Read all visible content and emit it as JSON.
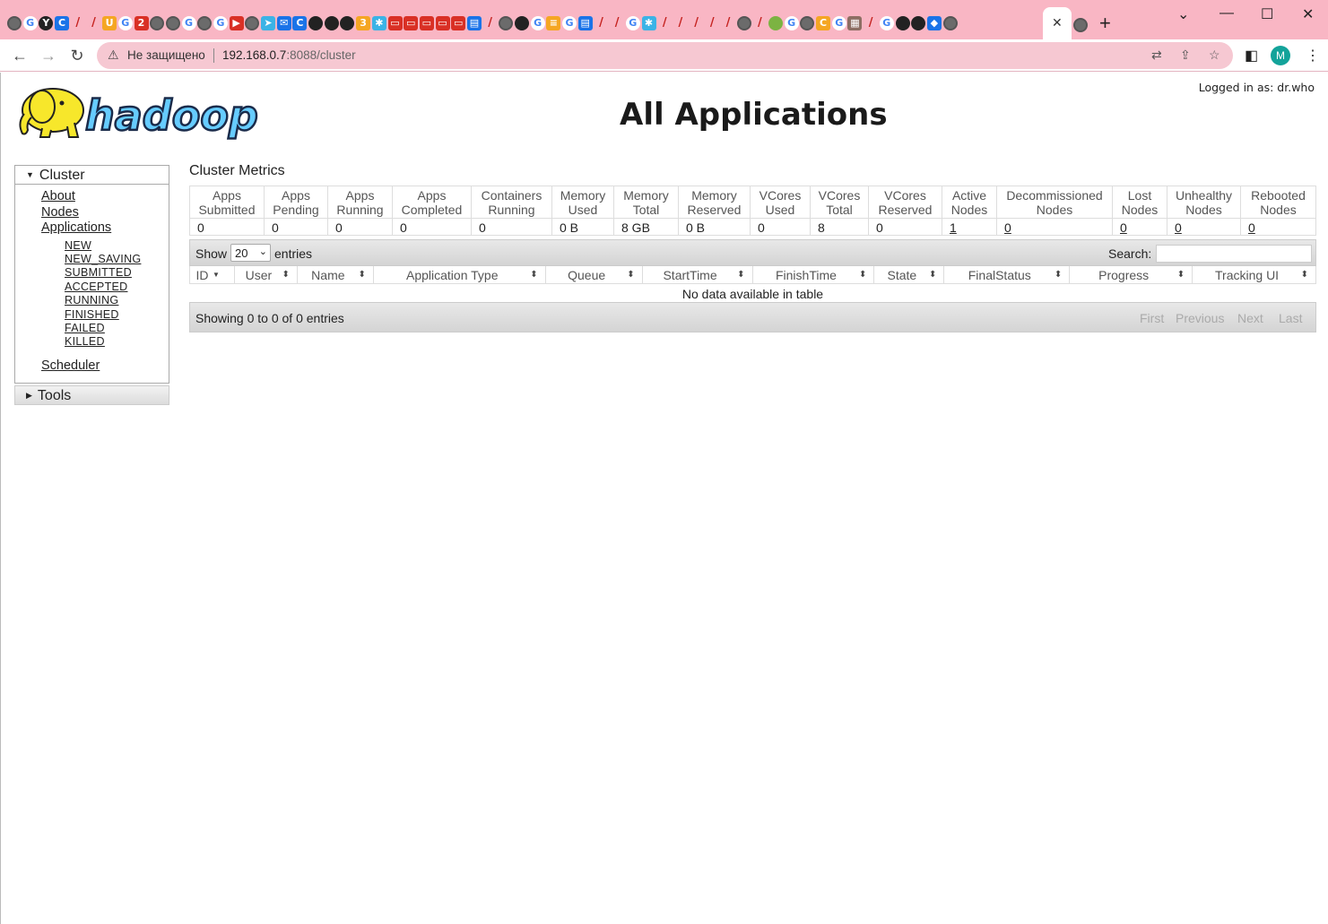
{
  "browser": {
    "tab_close": "✕",
    "new_tab": "+",
    "security_text": "Не защищено",
    "url_host": "192.168.0.7",
    "url_rest": ":8088/cluster",
    "profile_initial": "M"
  },
  "header": {
    "logo_text": "hadoop",
    "title": "All Applications",
    "login": "Logged in as: dr.who"
  },
  "sidebar": {
    "cluster_label": "Cluster",
    "links": [
      "About",
      "Nodes",
      "Applications"
    ],
    "app_states": [
      "NEW",
      "NEW_SAVING",
      "SUBMITTED",
      "ACCEPTED",
      "RUNNING",
      "FINISHED",
      "FAILED",
      "KILLED"
    ],
    "scheduler": "Scheduler",
    "tools_label": "Tools"
  },
  "metrics": {
    "title": "Cluster Metrics",
    "headers": [
      [
        "Apps",
        "Submitted"
      ],
      [
        "Apps",
        "Pending"
      ],
      [
        "Apps",
        "Running"
      ],
      [
        "Apps",
        "Completed"
      ],
      [
        "Containers",
        "Running"
      ],
      [
        "Memory",
        "Used"
      ],
      [
        "Memory",
        "Total"
      ],
      [
        "Memory",
        "Reserved"
      ],
      [
        "VCores",
        "Used"
      ],
      [
        "VCores",
        "Total"
      ],
      [
        "VCores",
        "Reserved"
      ],
      [
        "Active",
        "Nodes"
      ],
      [
        "Decommissioned",
        "Nodes"
      ],
      [
        "Lost",
        "Nodes"
      ],
      [
        "Unhealthy",
        "Nodes"
      ],
      [
        "Rebooted",
        "Nodes"
      ]
    ],
    "values": [
      "0",
      "0",
      "0",
      "0",
      "0",
      "0 B",
      "8 GB",
      "0 B",
      "0",
      "8",
      "0",
      "1",
      "0",
      "0",
      "0",
      "0"
    ]
  },
  "apps_table": {
    "show_label": "Show",
    "page_size": "20",
    "entries_label": "entries",
    "search_label": "Search:",
    "columns": [
      "ID",
      "User",
      "Name",
      "Application Type",
      "Queue",
      "StartTime",
      "FinishTime",
      "State",
      "FinalStatus",
      "Progress",
      "Tracking UI"
    ],
    "empty_text": "No data available in table",
    "info": "Showing 0 to 0 of 0 entries",
    "pager": [
      "First",
      "Previous",
      "Next",
      "Last"
    ]
  }
}
